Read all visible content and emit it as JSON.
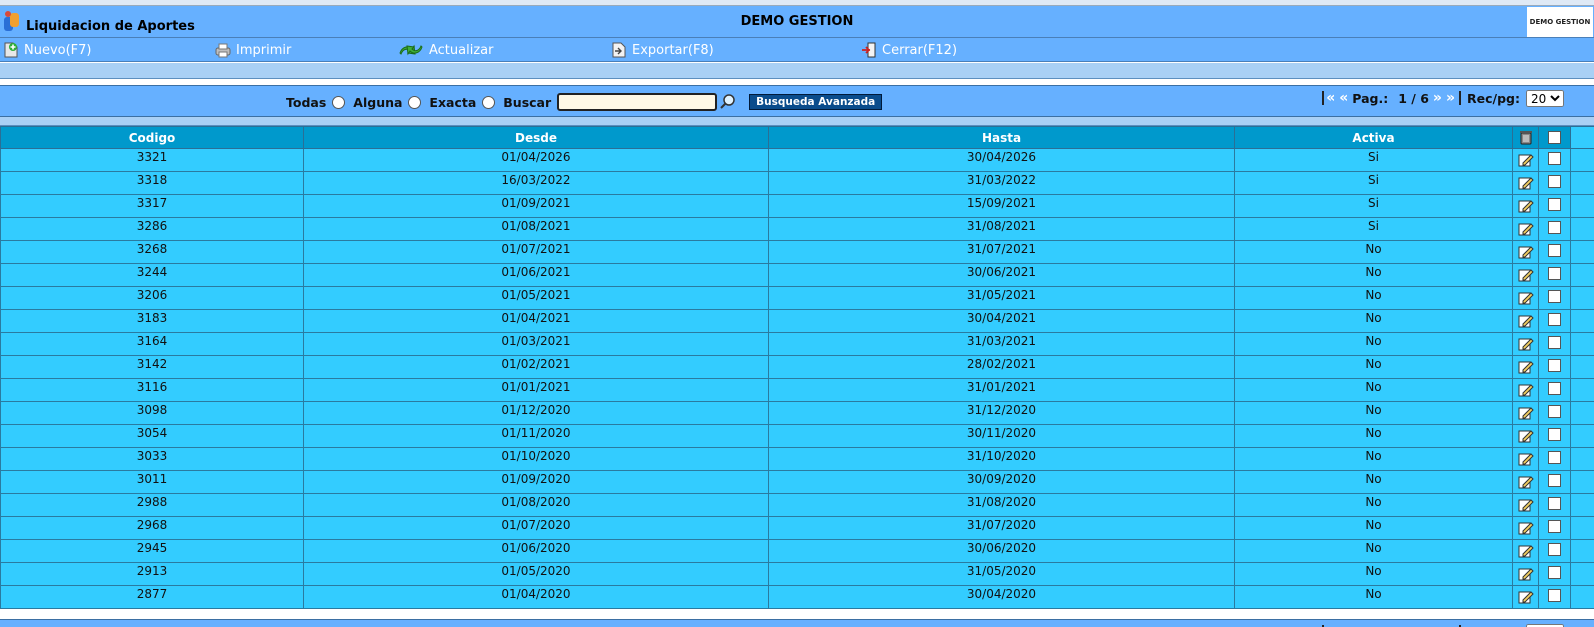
{
  "header": {
    "app_title": "Liquidacion de Aportes",
    "center_title": "DEMO GESTION",
    "logo_text": "DEMO GESTION"
  },
  "toolbar": {
    "nuevo": "Nuevo(F7)",
    "imprimir": "Imprimir",
    "actualizar": "Actualizar",
    "exportar": "Exportar(F8)",
    "cerrar": "Cerrar(F12)"
  },
  "search": {
    "todas": "Todas",
    "alguna": "Alguna",
    "exacta": "Exacta",
    "buscar": "Buscar",
    "advanced": "Busqueda Avanzada",
    "value": ""
  },
  "pager": {
    "first": "«",
    "prev": "«",
    "label": "Pag.:",
    "page": "1 / 6",
    "next": "»",
    "last": "»",
    "rec_label": "Rec/pg:",
    "rec_value": "20"
  },
  "table": {
    "headers": [
      "Codigo",
      "Desde",
      "Hasta",
      "Activa"
    ],
    "rows": [
      [
        "3321",
        "01/04/2026",
        "30/04/2026",
        "Si"
      ],
      [
        "3318",
        "16/03/2022",
        "31/03/2022",
        "Si"
      ],
      [
        "3317",
        "01/09/2021",
        "15/09/2021",
        "Si"
      ],
      [
        "3286",
        "01/08/2021",
        "31/08/2021",
        "Si"
      ],
      [
        "3268",
        "01/07/2021",
        "31/07/2021",
        "No"
      ],
      [
        "3244",
        "01/06/2021",
        "30/06/2021",
        "No"
      ],
      [
        "3206",
        "01/05/2021",
        "31/05/2021",
        "No"
      ],
      [
        "3183",
        "01/04/2021",
        "30/04/2021",
        "No"
      ],
      [
        "3164",
        "01/03/2021",
        "31/03/2021",
        "No"
      ],
      [
        "3142",
        "01/02/2021",
        "28/02/2021",
        "No"
      ],
      [
        "3116",
        "01/01/2021",
        "31/01/2021",
        "No"
      ],
      [
        "3098",
        "01/12/2020",
        "31/12/2020",
        "No"
      ],
      [
        "3054",
        "01/11/2020",
        "30/11/2020",
        "No"
      ],
      [
        "3033",
        "01/10/2020",
        "31/10/2020",
        "No"
      ],
      [
        "3011",
        "01/09/2020",
        "30/09/2020",
        "No"
      ],
      [
        "2988",
        "01/08/2020",
        "31/08/2020",
        "No"
      ],
      [
        "2968",
        "01/07/2020",
        "31/07/2020",
        "No"
      ],
      [
        "2945",
        "01/06/2020",
        "30/06/2020",
        "No"
      ],
      [
        "2913",
        "01/05/2020",
        "31/05/2020",
        "No"
      ],
      [
        "2877",
        "01/04/2020",
        "30/04/2020",
        "No"
      ]
    ]
  },
  "colors": {
    "bar": "#66b0ff",
    "header_cell": "#0099cc",
    "row_cell": "#33ccff",
    "button": "#0a4c8c"
  }
}
